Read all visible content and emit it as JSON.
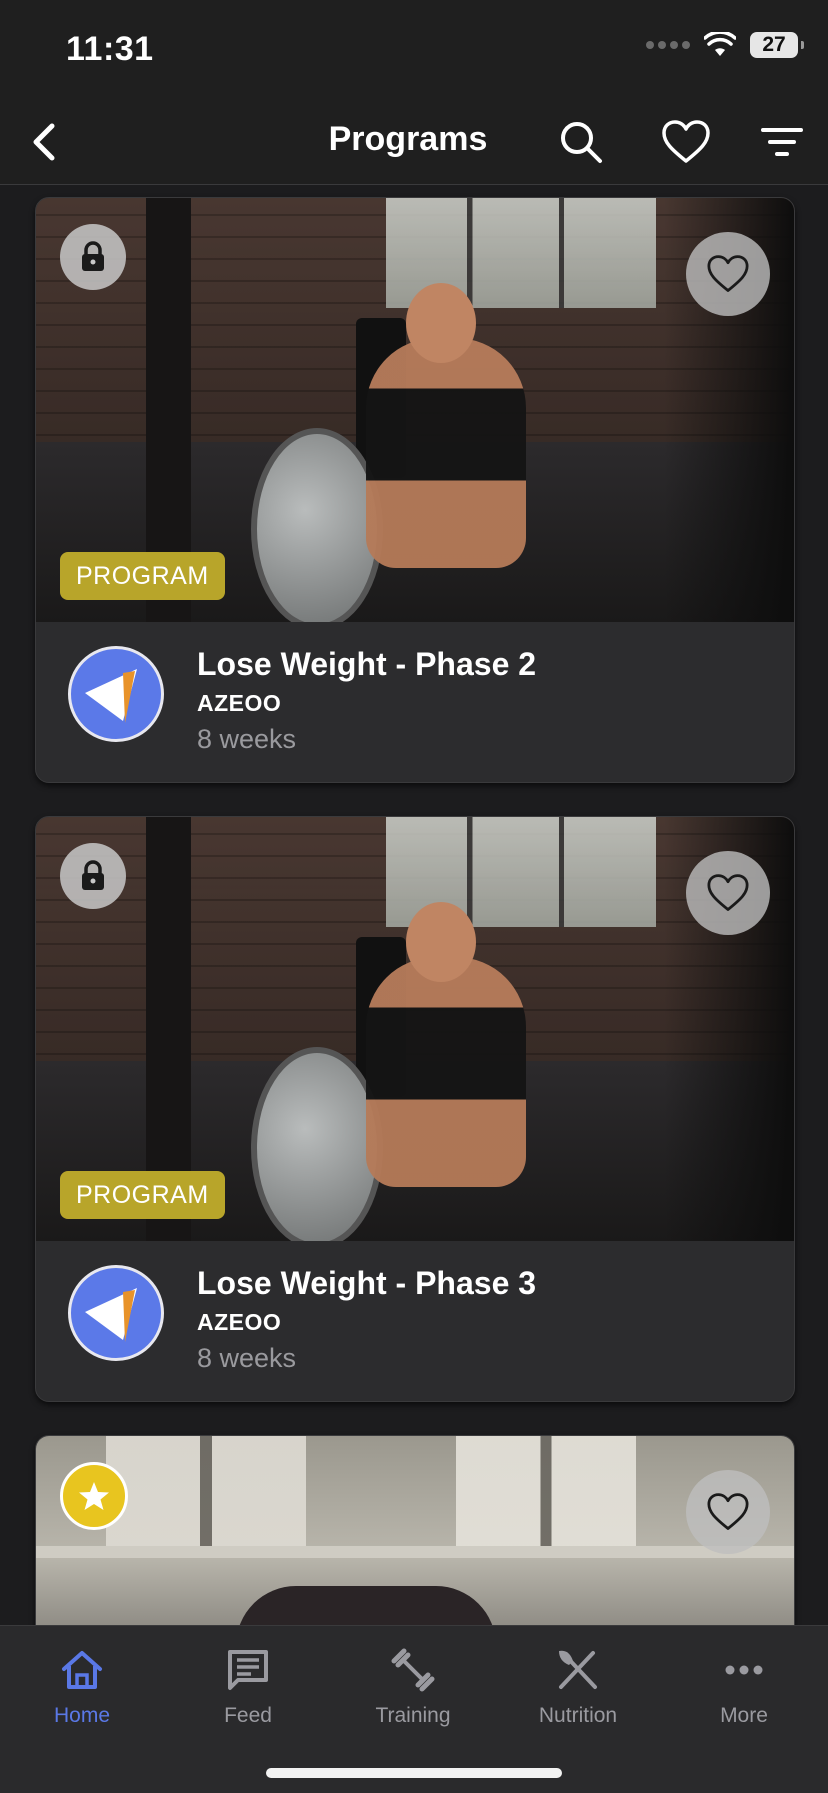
{
  "status_bar": {
    "time": "11:31",
    "battery": "27"
  },
  "nav": {
    "title": "Programs"
  },
  "cards": [
    {
      "tag": "PROGRAM",
      "title": "Lose Weight - Phase 2",
      "author": "AZEOO",
      "duration": "8 weeks"
    },
    {
      "tag": "PROGRAM",
      "title": "Lose Weight - Phase 3",
      "author": "AZEOO",
      "duration": "8 weeks"
    }
  ],
  "tab_bar": {
    "items": [
      {
        "label": "Home",
        "icon": "home-icon",
        "active": true
      },
      {
        "label": "Feed",
        "icon": "feed-icon"
      },
      {
        "label": "Training",
        "icon": "dumbbell-icon"
      },
      {
        "label": "Nutrition",
        "icon": "fork-knife-icon"
      },
      {
        "label": "More",
        "icon": "more-dots-icon"
      }
    ]
  },
  "colors": {
    "accent": "#5a78e6",
    "program_tag": "#b8a52a",
    "background": "#1c1c1e"
  }
}
